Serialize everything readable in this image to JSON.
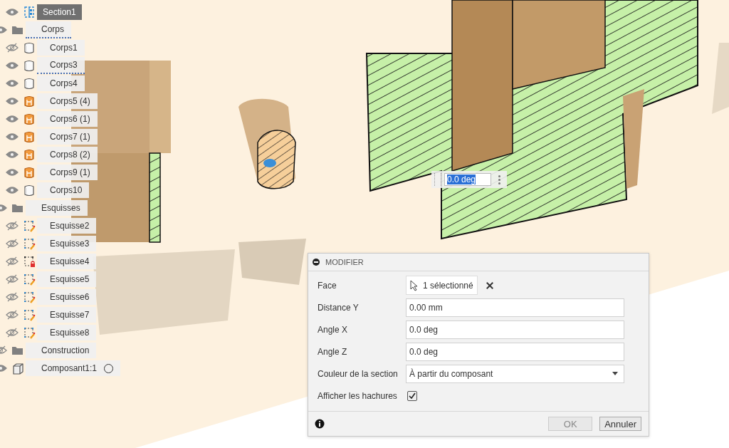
{
  "browser": {
    "items": [
      {
        "label": "Section1",
        "kind": "section",
        "visible": true,
        "selected": true,
        "underlined": false
      },
      {
        "label": "Corps",
        "kind": "folder",
        "visible": true,
        "selected": false,
        "underlined": true,
        "children": [
          {
            "label": "Corps1",
            "kind": "body",
            "visible": false,
            "selected": false,
            "underlined": false
          },
          {
            "label": "Corps3",
            "kind": "body",
            "visible": true,
            "selected": false,
            "underlined": true
          },
          {
            "label": "Corps4",
            "kind": "body",
            "visible": true,
            "selected": false,
            "underlined": false
          },
          {
            "label": "Corps5 (4)",
            "kind": "multibody",
            "visible": true,
            "selected": false,
            "underlined": false
          },
          {
            "label": "Corps6 (1)",
            "kind": "multibody",
            "visible": true,
            "selected": false,
            "underlined": false
          },
          {
            "label": "Corps7 (1)",
            "kind": "multibody",
            "visible": true,
            "selected": false,
            "underlined": false
          },
          {
            "label": "Corps8 (2)",
            "kind": "multibody",
            "visible": true,
            "selected": false,
            "underlined": false
          },
          {
            "label": "Corps9 (1)",
            "kind": "multibody",
            "visible": true,
            "selected": false,
            "underlined": false
          },
          {
            "label": "Corps10",
            "kind": "body",
            "visible": true,
            "selected": false,
            "underlined": false
          }
        ]
      },
      {
        "label": "Esquisses",
        "kind": "folder",
        "visible": true,
        "selected": false,
        "underlined": false,
        "children": [
          {
            "label": "Esquisse2",
            "kind": "sketch",
            "visible": false,
            "selected": false,
            "underlined": false
          },
          {
            "label": "Esquisse3",
            "kind": "sketch",
            "visible": false,
            "selected": false,
            "underlined": false
          },
          {
            "label": "Esquisse4",
            "kind": "lockedsketch",
            "visible": false,
            "selected": false,
            "underlined": false
          },
          {
            "label": "Esquisse5",
            "kind": "sketch",
            "visible": false,
            "selected": false,
            "underlined": false
          },
          {
            "label": "Esquisse6",
            "kind": "sketch",
            "visible": false,
            "selected": false,
            "underlined": false
          },
          {
            "label": "Esquisse7",
            "kind": "sketch",
            "visible": false,
            "selected": false,
            "underlined": false
          },
          {
            "label": "Esquisse8",
            "kind": "sketch",
            "visible": false,
            "selected": false,
            "underlined": false
          }
        ]
      },
      {
        "label": "Construction",
        "kind": "folder",
        "visible": false,
        "selected": false,
        "underlined": false
      },
      {
        "label": "Composant1:1",
        "kind": "component",
        "visible": true,
        "selected": false,
        "underlined": false,
        "active": false
      }
    ]
  },
  "viewport": {
    "inline_input": {
      "value": "0.0 deg"
    }
  },
  "dialog": {
    "title": "MODIFIER",
    "rows": [
      {
        "kind": "selection",
        "label": "Face",
        "value": "1 sélectionné"
      },
      {
        "kind": "input",
        "label": "Distance Y",
        "value": "0.00 mm"
      },
      {
        "kind": "input",
        "label": "Angle X",
        "value": "0.0 deg"
      },
      {
        "kind": "input",
        "label": "Angle Z",
        "value": "0.0 deg"
      },
      {
        "kind": "dropdown",
        "label": "Couleur de la section",
        "value": "À partir du composant"
      },
      {
        "kind": "checkbox",
        "label": "Afficher les hachures",
        "checked": true
      }
    ],
    "buttons": [
      {
        "label": "OK",
        "disabled": true
      },
      {
        "label": "Annuler",
        "disabled": false
      }
    ]
  }
}
